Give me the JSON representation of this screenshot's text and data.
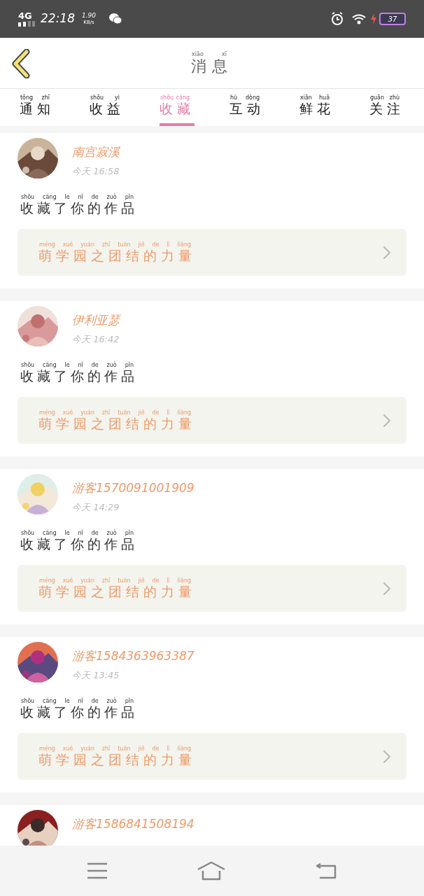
{
  "status_bar": {
    "network": "4G",
    "time": "22:18",
    "speed": "1.90",
    "speed_unit": "KB/s",
    "battery": "37"
  },
  "header": {
    "title": "消息",
    "title_pinyin": "xiāo xī"
  },
  "tabs": [
    {
      "label": "通知",
      "pinyin": "tōng zhī",
      "selected": false
    },
    {
      "label": "收益",
      "pinyin": "shōu yì",
      "selected": false
    },
    {
      "label": "收藏",
      "pinyin": "shōu cáng",
      "selected": true
    },
    {
      "label": "互动",
      "pinyin": "hù dòng",
      "selected": false
    },
    {
      "label": "鲜花",
      "pinyin": "xiān huā",
      "selected": false
    },
    {
      "label": "关注",
      "pinyin": "guān zhù",
      "selected": false
    }
  ],
  "messages": [
    {
      "user": "南宫寂溪",
      "time": "今天 16:58",
      "action": "收藏了你的作品",
      "action_pinyin": "shōu cáng le nǐ de zuò pǐn",
      "work": "萌学园之团结的力量",
      "work_pinyin": "méng xué yuán zhī tuán jié de lì liàng"
    },
    {
      "user": "伊利亚瑟",
      "time": "今天 16:42",
      "action": "收藏了你的作品",
      "action_pinyin": "shōu cáng le nǐ de zuò pǐn",
      "work": "萌学园之团结的力量",
      "work_pinyin": "méng xué yuán zhī tuán jié de lì liàng"
    },
    {
      "user": "游客1570091001909",
      "time": "今天 14:29",
      "action": "收藏了你的作品",
      "action_pinyin": "shōu cáng le nǐ de zuò pǐn",
      "work": "萌学园之团结的力量",
      "work_pinyin": "méng xué yuán zhī tuán jié de lì liàng"
    },
    {
      "user": "游客1584363963387",
      "time": "今天 13:45",
      "action": "收藏了你的作品",
      "action_pinyin": "shōu cáng le nǐ de zuò pǐn",
      "work": "萌学园之团结的力量",
      "work_pinyin": "méng xué yuán zhī tuán jié de lì liàng"
    },
    {
      "user": "游客1586841508194"
    }
  ]
}
